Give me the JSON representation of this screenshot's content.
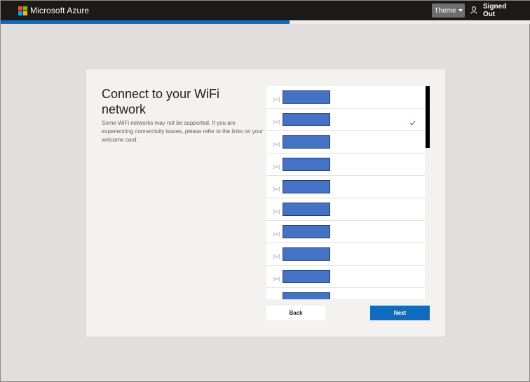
{
  "header": {
    "brand": "Microsoft Azure",
    "theme_label": "Theme",
    "user_status": "Signed\nOut",
    "logo_colors": [
      "#f25022",
      "#7fba00",
      "#00a4ef",
      "#ffb900"
    ]
  },
  "progress": {
    "fraction": 0.545,
    "color": "#0f6cbd"
  },
  "page": {
    "title": "Connect to your WiFi network",
    "description": "Some WiFi networks may not be supported. If you are experiencing connectivity issues, please refer to the links on your welcome card."
  },
  "networks": [
    {
      "ssid": "",
      "selected": false
    },
    {
      "ssid": "",
      "selected": true
    },
    {
      "ssid": "",
      "selected": false
    },
    {
      "ssid": "",
      "selected": false
    },
    {
      "ssid": "",
      "selected": false
    },
    {
      "ssid": "",
      "selected": false
    },
    {
      "ssid": "",
      "selected": false
    },
    {
      "ssid": "",
      "selected": false
    },
    {
      "ssid": "",
      "selected": false
    },
    {
      "ssid": "",
      "selected": false
    }
  ],
  "buttons": {
    "back": "Back",
    "next": "Next"
  },
  "colors": {
    "accent": "#0f6cbd",
    "redaction": "#4472c4"
  }
}
